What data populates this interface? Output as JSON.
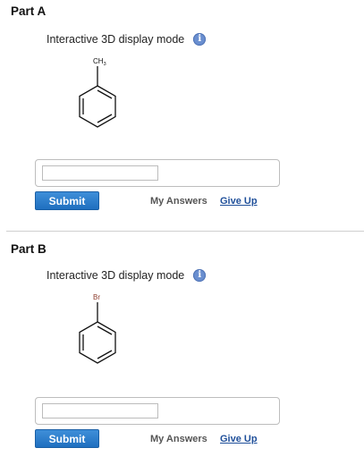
{
  "parts": [
    {
      "title": "Part A",
      "mode_label": "Interactive 3D display mode",
      "info_symbol": "i",
      "substituent": "CH",
      "substituent_sub": "3",
      "answer_value": "",
      "submit_label": "Submit",
      "my_answers_label": "My Answers",
      "give_up_label": "Give Up"
    },
    {
      "title": "Part B",
      "mode_label": "Interactive 3D display mode",
      "info_symbol": "i",
      "substituent": "Br",
      "answer_value": "",
      "submit_label": "Submit",
      "my_answers_label": "My Answers",
      "give_up_label": "Give Up"
    }
  ],
  "colors": {
    "accent": "#1f6fbf",
    "link": "#1f4f9a",
    "info_icon": "#6a8fd0",
    "bromine": "#8b3a2a"
  },
  "icons": {
    "info": "info-icon"
  }
}
